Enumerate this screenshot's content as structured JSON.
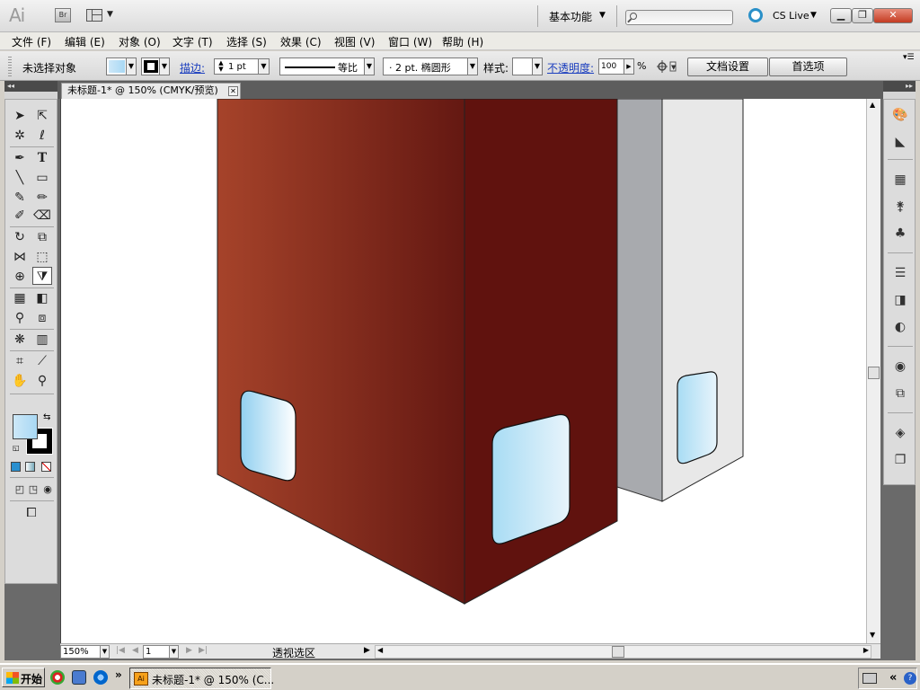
{
  "app": {
    "logo": "Ai",
    "bridge_label": "Br",
    "workspace": "基本功能",
    "cs_live": "CS Live"
  },
  "menu": [
    {
      "label": "文件 (F)"
    },
    {
      "label": "编辑 (E)"
    },
    {
      "label": "对象 (O)"
    },
    {
      "label": "文字 (T)"
    },
    {
      "label": "选择 (S)"
    },
    {
      "label": "效果 (C)"
    },
    {
      "label": "视图 (V)"
    },
    {
      "label": "窗口 (W)"
    },
    {
      "label": "帮助 (H)"
    }
  ],
  "control_bar": {
    "selection_status": "未选择对象",
    "stroke_label": "描边:",
    "stroke_weight": "1 pt",
    "profile": "等比",
    "brush": "·  2 pt. 椭圆形",
    "style_label": "样式:",
    "opacity_label": "不透明度:",
    "opacity_value": "100",
    "percent": "%",
    "doc_setup": "文档设置",
    "preferences": "首选项"
  },
  "document": {
    "tab_title": "未标题-1* @ 150% (CMYK/预览)",
    "zoom": "150%",
    "page": "1",
    "status_text": "透视选区"
  },
  "taskbar": {
    "start": "开始",
    "more": "»",
    "task_label": "未标题-1* @ 150% (C..."
  },
  "colors": {
    "front_face_left": "#a6432a",
    "front_face_right": "#641812",
    "side_face": "#60120e",
    "grey_face": "#a8aaae",
    "light_face": "#e8e8e8",
    "window_light": "#e8f4fb",
    "window_blue": "#92d0f0",
    "accent_link": "#1c3fbf"
  },
  "icons": {
    "tools": [
      "selection-tool-icon",
      "direct-selection-tool-icon",
      "magic-wand-icon",
      "lasso-icon",
      "pen-tool-icon",
      "type-tool-icon",
      "line-tool-icon",
      "rectangle-tool-icon",
      "paintbrush-icon",
      "pencil-icon",
      "blob-brush-icon",
      "eraser-icon",
      "rotate-icon",
      "scale-icon",
      "width-tool-icon",
      "free-transform-icon",
      "shape-builder-icon",
      "perspective-grid-icon",
      "mesh-icon",
      "gradient-icon",
      "eyedropper-icon",
      "blend-icon",
      "symbol-sprayer-icon",
      "graph-icon",
      "artboard-icon",
      "slice-icon",
      "hand-icon",
      "zoom-icon"
    ],
    "panels": [
      "color-panel-icon",
      "color-guide-icon",
      "swatches-icon",
      "brushes-icon",
      "symbols-icon",
      "stroke-panel-icon",
      "gradient-panel-icon",
      "transparency-icon",
      "appearance-icon",
      "graphic-styles-icon",
      "layers-icon",
      "artboards-icon"
    ]
  }
}
